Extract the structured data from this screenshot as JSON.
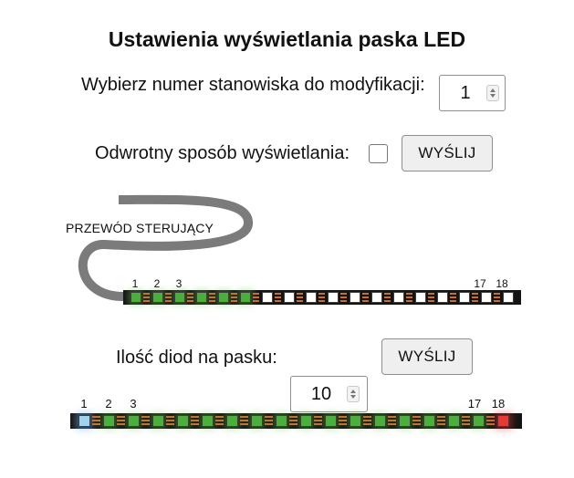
{
  "page_title": "Ustawienia wyświetlania paska LED",
  "station": {
    "label": "Wybierz numer stanowiska do modyfikacji:",
    "value": "1"
  },
  "reverse": {
    "label": "Odwrotny sposób wyświetlania:",
    "checked": false,
    "button": "WYŚLIJ"
  },
  "wire_label": "PRZEWÓD STERUJĄCY",
  "strip_top": {
    "led_count": 18,
    "numbers_left": [
      "1",
      "2",
      "3"
    ],
    "numbers_right": [
      "17",
      "18"
    ],
    "colors": {
      "green": "#4caf3d",
      "white": "#ffffff",
      "pads": "#c8702b"
    }
  },
  "leds": {
    "label": "Ilość diod na pasku:",
    "value": "10",
    "button": "WYŚLIJ"
  },
  "strip_bottom": {
    "led_count": 18,
    "numbers_left": [
      "1",
      "2",
      "3"
    ],
    "numbers_right": [
      "17",
      "18"
    ],
    "colors": {
      "first": "#9fd4f0",
      "last": "#e53935",
      "green": "#4caf3d"
    }
  }
}
